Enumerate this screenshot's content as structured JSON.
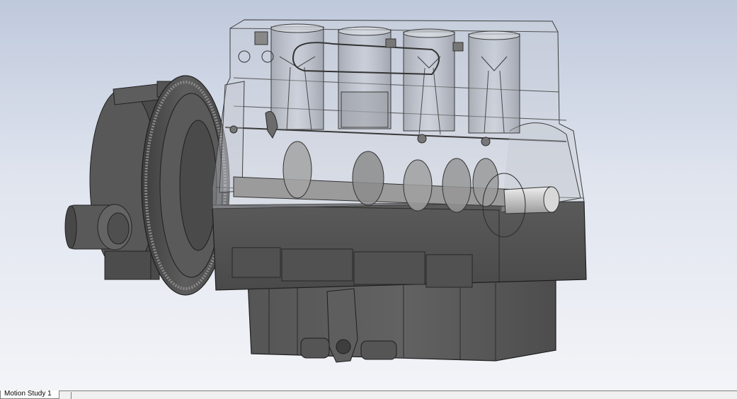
{
  "viewport": {
    "model": "engine-assembly",
    "background_top": "#bfc9dc",
    "background_bottom": "#f3f4f8",
    "body_color": "#5c5c5c",
    "transparent_block_color": "#c8ccd4"
  },
  "bottom_tabs": {
    "active_tab_label": "Motion Study 1"
  }
}
